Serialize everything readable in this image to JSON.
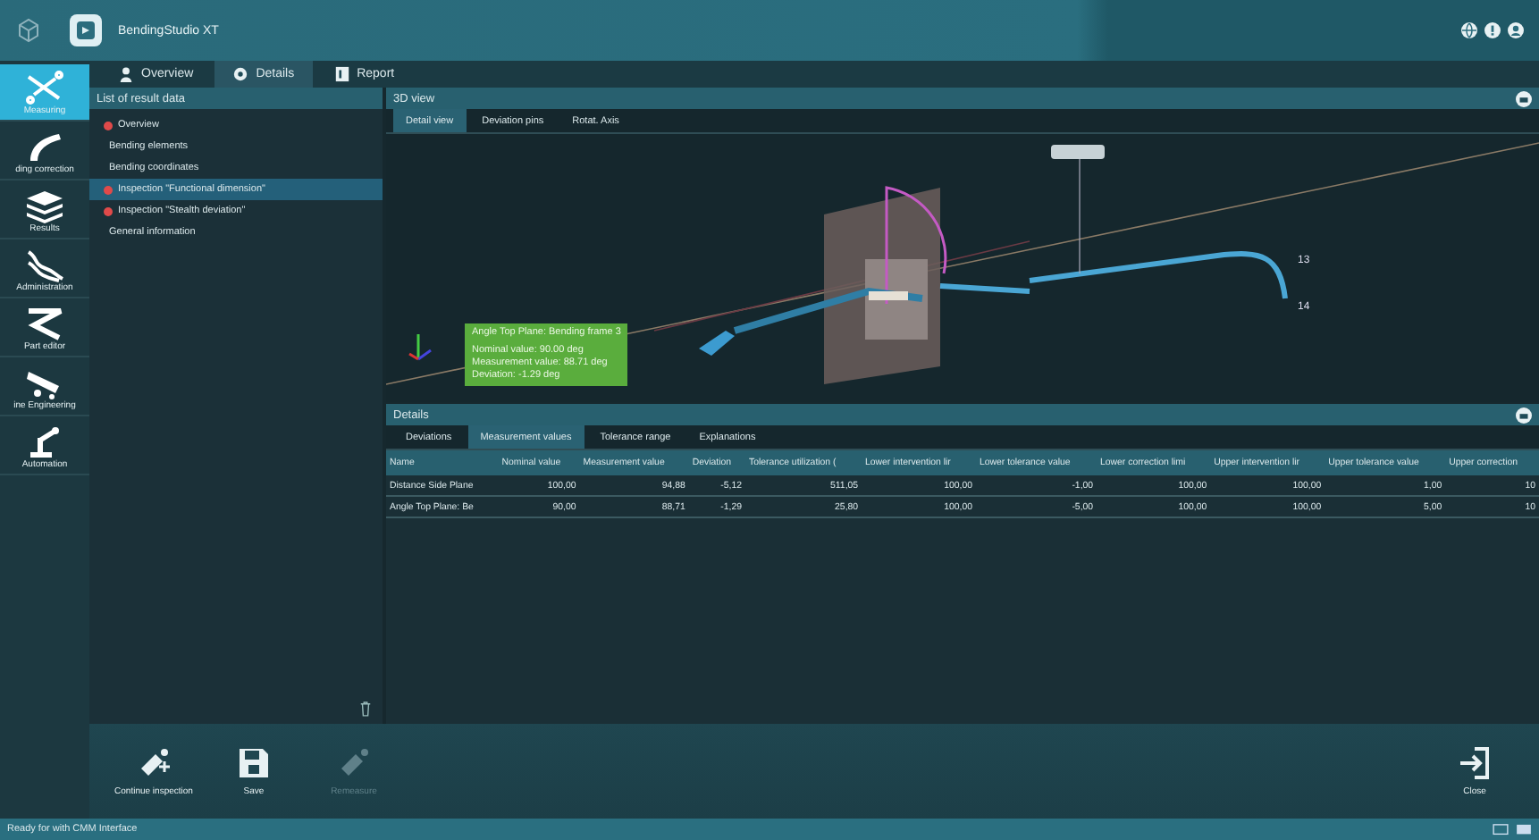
{
  "window": {
    "title": "BendingStudio XT"
  },
  "rail": [
    {
      "label": "Measuring",
      "kind": "measure",
      "selected": true
    },
    {
      "label": "ding correction",
      "kind": "correction",
      "selected": false
    },
    {
      "label": "Results",
      "kind": "results",
      "selected": false
    },
    {
      "label": "Administration",
      "kind": "admin",
      "selected": false
    },
    {
      "label": "Part editor",
      "kind": "editor",
      "selected": false
    },
    {
      "label": "ine Engineering",
      "kind": "engineering",
      "selected": false
    },
    {
      "label": "Automation",
      "kind": "automation",
      "selected": false
    }
  ],
  "tabs": [
    {
      "label": "Overview",
      "kind": "overview",
      "selected": false
    },
    {
      "label": "Details",
      "kind": "details",
      "selected": true
    },
    {
      "label": "Report",
      "kind": "report",
      "selected": false
    }
  ],
  "result_list": {
    "title": "List of result data",
    "items": [
      {
        "label": "Overview",
        "error": true,
        "selected": false
      },
      {
        "label": "Bending elements",
        "error": false,
        "selected": false
      },
      {
        "label": "Bending coordinates",
        "error": false,
        "selected": false
      },
      {
        "label": "Inspection \"Functional dimension\"",
        "error": true,
        "selected": true
      },
      {
        "label": "Inspection \"Stealth deviation\"",
        "error": true,
        "selected": false
      },
      {
        "label": "General information",
        "error": false,
        "selected": false
      }
    ]
  },
  "view3d": {
    "title": "3D view",
    "tabs": [
      {
        "label": "Detail view",
        "selected": true
      },
      {
        "label": "Deviation pins",
        "selected": false
      },
      {
        "label": "Rotat. Axis",
        "selected": false
      }
    ],
    "point_labels": [
      "13",
      "14"
    ],
    "tooltip": {
      "title": "Angle Top Plane: Bending frame 3",
      "lines": [
        "Nominal value: 90.00 deg",
        "Measurement value: 88.71 deg",
        "Deviation: -1.29 deg"
      ]
    }
  },
  "details": {
    "title": "Details",
    "tabs": [
      {
        "label": "Deviations",
        "selected": false
      },
      {
        "label": "Measurement values",
        "selected": true
      },
      {
        "label": "Tolerance range",
        "selected": false
      },
      {
        "label": "Explanations",
        "selected": false
      }
    ],
    "columns": [
      "Name",
      "Nominal value",
      "Measurement value",
      "Deviation",
      "Tolerance utilization (",
      "Lower intervention lir",
      "Lower tolerance value",
      "Lower correction limi",
      "Upper intervention lir",
      "Upper tolerance value",
      "Upper correction"
    ],
    "rows": [
      [
        "Distance Side Plane",
        "100,00",
        "94,88",
        "-5,12",
        "511,05",
        "100,00",
        "-1,00",
        "100,00",
        "100,00",
        "1,00",
        "10"
      ],
      [
        "Angle Top Plane: Be",
        "90,00",
        "88,71",
        "-1,29",
        "25,80",
        "100,00",
        "-5,00",
        "100,00",
        "100,00",
        "5,00",
        "10"
      ]
    ]
  },
  "toolbar": [
    {
      "label": "Continue inspection",
      "kind": "continue",
      "disabled": false
    },
    {
      "label": "Save",
      "kind": "save",
      "disabled": false
    },
    {
      "label": "Remeasure",
      "kind": "remeasure",
      "disabled": true
    }
  ],
  "close_button": {
    "label": "Close"
  },
  "status_bar": {
    "text": "Ready for with CMM Interface"
  }
}
